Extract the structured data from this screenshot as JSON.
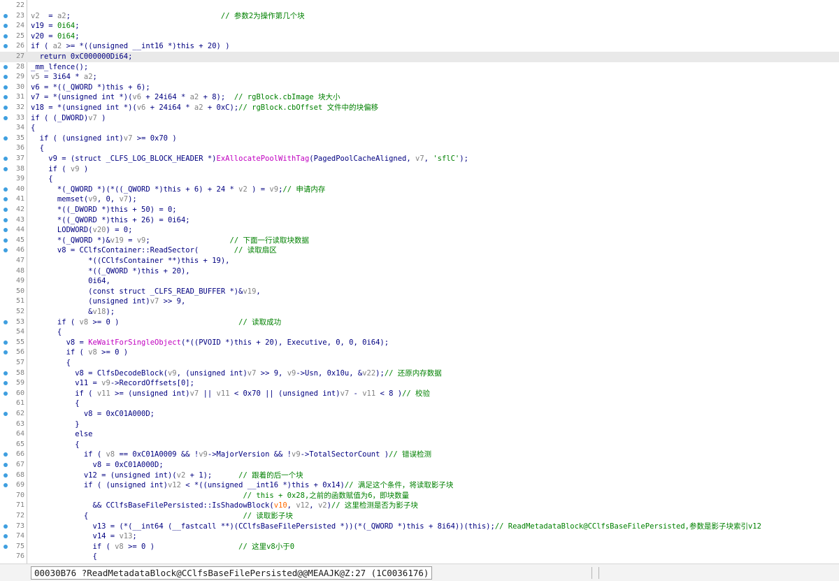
{
  "status": {
    "text": "00030B76 ?ReadMetadataBlock@CClfsBaseFilePersisted@@MEAAJK@Z:27 (1C0036176)"
  },
  "colors": {
    "breakpoint": "#3f9fe0",
    "comment": "#008000",
    "number": "#008000",
    "variable": "#808080",
    "api": "#c000c0",
    "highlight_line": "#e9e9e9"
  },
  "lines": [
    {
      "n": "22",
      "bp": false,
      "hl": false,
      "t": []
    },
    {
      "n": "23",
      "bp": true,
      "hl": false,
      "t": [
        [
          "v",
          "v2"
        ],
        [
          "",
          "  = "
        ],
        [
          "v",
          "a2"
        ],
        [
          "",
          ";                                  "
        ],
        [
          "c",
          "// 参数2为操作第几个块"
        ]
      ]
    },
    {
      "n": "24",
      "bp": true,
      "hl": false,
      "t": [
        [
          "",
          "v19 = "
        ],
        [
          "num",
          "0i64"
        ],
        [
          "",
          ";"
        ]
      ]
    },
    {
      "n": "25",
      "bp": true,
      "hl": false,
      "t": [
        [
          "",
          "v20 = "
        ],
        [
          "num",
          "0i64"
        ],
        [
          "",
          ";"
        ]
      ]
    },
    {
      "n": "26",
      "bp": true,
      "hl": false,
      "t": [
        [
          "",
          "if ( "
        ],
        [
          "v",
          "a2"
        ],
        [
          "",
          " >= *((unsigned __int16 *)"
        ],
        [
          "kw",
          "this"
        ],
        [
          "",
          " + 20) )"
        ]
      ]
    },
    {
      "n": "27",
      "bp": false,
      "hl": true,
      "t": [
        [
          "",
          "  return 0xC000000Di64;"
        ]
      ]
    },
    {
      "n": "28",
      "bp": true,
      "hl": false,
      "t": [
        [
          "",
          "_mm_lfence();"
        ]
      ]
    },
    {
      "n": "29",
      "bp": true,
      "hl": false,
      "t": [
        [
          "v",
          "v5"
        ],
        [
          "",
          " = 3i64 * "
        ],
        [
          "v",
          "a2"
        ],
        [
          "",
          ";"
        ]
      ]
    },
    {
      "n": "30",
      "bp": true,
      "hl": false,
      "t": [
        [
          "",
          "v6 = *((_QWORD *)"
        ],
        [
          "kw",
          "this"
        ],
        [
          "",
          " + 6);"
        ]
      ]
    },
    {
      "n": "31",
      "bp": true,
      "hl": false,
      "t": [
        [
          "",
          "v7 = *(unsigned int *)("
        ],
        [
          "v",
          "v6"
        ],
        [
          "",
          " + 24i64 * "
        ],
        [
          "v",
          "a2"
        ],
        [
          "",
          " + 8);  "
        ],
        [
          "c",
          "// rgBlock.cbImage 块大小"
        ]
      ]
    },
    {
      "n": "32",
      "bp": true,
      "hl": false,
      "t": [
        [
          "",
          "v18 = *(unsigned int *)("
        ],
        [
          "v",
          "v6"
        ],
        [
          "",
          " + 24i64 * "
        ],
        [
          "v",
          "a2"
        ],
        [
          "",
          " + 0xC);"
        ],
        [
          "c",
          "// rgBlock.cbOffset 文件中的块偏移"
        ]
      ]
    },
    {
      "n": "33",
      "bp": true,
      "hl": false,
      "t": [
        [
          "",
          "if ( (_DWORD)"
        ],
        [
          "v",
          "v7"
        ],
        [
          "",
          " )"
        ]
      ]
    },
    {
      "n": "34",
      "bp": false,
      "hl": false,
      "t": [
        [
          "",
          "{"
        ]
      ]
    },
    {
      "n": "35",
      "bp": true,
      "hl": false,
      "t": [
        [
          "",
          "  if ( (unsigned int)"
        ],
        [
          "v",
          "v7"
        ],
        [
          "",
          " >= 0x70 )"
        ]
      ]
    },
    {
      "n": "36",
      "bp": false,
      "hl": false,
      "t": [
        [
          "",
          "  {"
        ]
      ]
    },
    {
      "n": "37",
      "bp": true,
      "hl": false,
      "t": [
        [
          "",
          "    v9 = (struct _CLFS_LOG_BLOCK_HEADER *)"
        ],
        [
          "api",
          "ExAllocatePoolWithTag"
        ],
        [
          "",
          "(PagedPoolCacheAligned, "
        ],
        [
          "v",
          "v7"
        ],
        [
          "",
          ", "
        ],
        [
          "str",
          "'sflC'"
        ],
        [
          "",
          ");"
        ]
      ]
    },
    {
      "n": "38",
      "bp": true,
      "hl": false,
      "t": [
        [
          "",
          "    if ( "
        ],
        [
          "v",
          "v9"
        ],
        [
          "",
          " )"
        ]
      ]
    },
    {
      "n": "39",
      "bp": false,
      "hl": false,
      "t": [
        [
          "",
          "    {"
        ]
      ]
    },
    {
      "n": "40",
      "bp": true,
      "hl": false,
      "t": [
        [
          "",
          "      *(_QWORD *)(*((_QWORD *)"
        ],
        [
          "kw",
          "this"
        ],
        [
          "",
          " + 6) + 24 * "
        ],
        [
          "v",
          "v2"
        ],
        [
          "",
          " ) = "
        ],
        [
          "v",
          "v9"
        ],
        [
          "",
          ";"
        ],
        [
          "c",
          "// 申请内存"
        ]
      ]
    },
    {
      "n": "41",
      "bp": true,
      "hl": false,
      "t": [
        [
          "",
          "      memset("
        ],
        [
          "v",
          "v9"
        ],
        [
          "",
          ", 0, "
        ],
        [
          "v",
          "v7"
        ],
        [
          "",
          ");"
        ]
      ]
    },
    {
      "n": "42",
      "bp": true,
      "hl": false,
      "t": [
        [
          "",
          "      *((_DWORD *)"
        ],
        [
          "kw",
          "this"
        ],
        [
          "",
          " + 50) = 0;"
        ]
      ]
    },
    {
      "n": "43",
      "bp": true,
      "hl": false,
      "t": [
        [
          "",
          "      *((_QWORD *)"
        ],
        [
          "kw",
          "this"
        ],
        [
          "",
          " + 26) = 0i64;"
        ]
      ]
    },
    {
      "n": "44",
      "bp": true,
      "hl": false,
      "t": [
        [
          "",
          "      LODWORD("
        ],
        [
          "v",
          "v20"
        ],
        [
          "",
          ") = 0;"
        ]
      ]
    },
    {
      "n": "45",
      "bp": true,
      "hl": false,
      "t": [
        [
          "",
          "      *(_QWORD *)&"
        ],
        [
          "v",
          "v19"
        ],
        [
          "",
          " = "
        ],
        [
          "v",
          "v9"
        ],
        [
          "",
          ";                  "
        ],
        [
          "c",
          "// 下面一行读取块数据"
        ]
      ]
    },
    {
      "n": "46",
      "bp": true,
      "hl": false,
      "t": [
        [
          "",
          "      v8 = CClfsContainer::ReadSector(        "
        ],
        [
          "c",
          "// 读取扇区"
        ]
      ]
    },
    {
      "n": "47",
      "bp": false,
      "hl": false,
      "t": [
        [
          "",
          "             *((CClfsContainer **)"
        ],
        [
          "kw",
          "this"
        ],
        [
          "",
          " + 19),"
        ]
      ]
    },
    {
      "n": "48",
      "bp": false,
      "hl": false,
      "t": [
        [
          "",
          "             *((_QWORD *)"
        ],
        [
          "kw",
          "this"
        ],
        [
          "",
          " + 20),"
        ]
      ]
    },
    {
      "n": "49",
      "bp": false,
      "hl": false,
      "t": [
        [
          "",
          "             0i64,"
        ]
      ]
    },
    {
      "n": "50",
      "bp": false,
      "hl": false,
      "t": [
        [
          "",
          "             (const struct _CLFS_READ_BUFFER *)&"
        ],
        [
          "v",
          "v19"
        ],
        [
          "",
          ","
        ]
      ]
    },
    {
      "n": "51",
      "bp": false,
      "hl": false,
      "t": [
        [
          "",
          "             (unsigned int)"
        ],
        [
          "v",
          "v7"
        ],
        [
          "",
          " >> 9,"
        ]
      ]
    },
    {
      "n": "52",
      "bp": false,
      "hl": false,
      "t": [
        [
          "",
          "             &"
        ],
        [
          "v",
          "v18"
        ],
        [
          "",
          ");"
        ]
      ]
    },
    {
      "n": "53",
      "bp": true,
      "hl": false,
      "t": [
        [
          "",
          "      if ( "
        ],
        [
          "v",
          "v8"
        ],
        [
          "",
          " >= 0 )                           "
        ],
        [
          "c",
          "// 读取成功"
        ]
      ]
    },
    {
      "n": "54",
      "bp": false,
      "hl": false,
      "t": [
        [
          "",
          "      {"
        ]
      ]
    },
    {
      "n": "55",
      "bp": true,
      "hl": false,
      "t": [
        [
          "",
          "        v8 = "
        ],
        [
          "api",
          "KeWaitForSingleObject"
        ],
        [
          "",
          "(*((PVOID *)"
        ],
        [
          "kw",
          "this"
        ],
        [
          "",
          " + 20), Executive, 0, 0, 0i64);"
        ]
      ]
    },
    {
      "n": "56",
      "bp": true,
      "hl": false,
      "t": [
        [
          "",
          "        if ( "
        ],
        [
          "v",
          "v8"
        ],
        [
          "",
          " >= 0 )"
        ]
      ]
    },
    {
      "n": "57",
      "bp": false,
      "hl": false,
      "t": [
        [
          "",
          "        {"
        ]
      ]
    },
    {
      "n": "58",
      "bp": true,
      "hl": false,
      "t": [
        [
          "",
          "          v8 = ClfsDecodeBlock("
        ],
        [
          "v",
          "v9"
        ],
        [
          "",
          ", (unsigned int)"
        ],
        [
          "v",
          "v7"
        ],
        [
          "",
          " >> 9, "
        ],
        [
          "v",
          "v9"
        ],
        [
          "",
          "->Usn, 0x10u, &"
        ],
        [
          "v",
          "v22"
        ],
        [
          "",
          ");"
        ],
        [
          "c",
          "// 还原内存数据"
        ]
      ]
    },
    {
      "n": "59",
      "bp": true,
      "hl": false,
      "t": [
        [
          "",
          "          v11 = "
        ],
        [
          "v",
          "v9"
        ],
        [
          "",
          "->RecordOffsets[0];"
        ]
      ]
    },
    {
      "n": "60",
      "bp": true,
      "hl": false,
      "t": [
        [
          "",
          "          if ( "
        ],
        [
          "v",
          "v11"
        ],
        [
          "",
          " >= (unsigned int)"
        ],
        [
          "v",
          "v7"
        ],
        [
          "",
          " || "
        ],
        [
          "v",
          "v11"
        ],
        [
          "",
          " < 0x70 || (unsigned int)"
        ],
        [
          "v",
          "v7"
        ],
        [
          "",
          " - "
        ],
        [
          "v",
          "v11"
        ],
        [
          "",
          " < 8 )"
        ],
        [
          "c",
          "// 校验"
        ]
      ]
    },
    {
      "n": "61",
      "bp": false,
      "hl": false,
      "t": [
        [
          "",
          "          {"
        ]
      ]
    },
    {
      "n": "62",
      "bp": true,
      "hl": false,
      "t": [
        [
          "",
          "            v8 = 0xC01A000D;"
        ]
      ]
    },
    {
      "n": "63",
      "bp": false,
      "hl": false,
      "t": [
        [
          "",
          "          }"
        ]
      ]
    },
    {
      "n": "64",
      "bp": false,
      "hl": false,
      "t": [
        [
          "",
          "          else"
        ]
      ]
    },
    {
      "n": "65",
      "bp": false,
      "hl": false,
      "t": [
        [
          "",
          "          {"
        ]
      ]
    },
    {
      "n": "66",
      "bp": true,
      "hl": false,
      "t": [
        [
          "",
          "            if ( "
        ],
        [
          "v",
          "v8"
        ],
        [
          "",
          " == 0xC01A0009 && !"
        ],
        [
          "v",
          "v9"
        ],
        [
          "",
          "->MajorVersion && !"
        ],
        [
          "v",
          "v9"
        ],
        [
          "",
          "->TotalSectorCount )"
        ],
        [
          "c",
          "// 错误检测"
        ]
      ]
    },
    {
      "n": "67",
      "bp": true,
      "hl": false,
      "t": [
        [
          "",
          "              v8 = 0xC01A000D;"
        ]
      ]
    },
    {
      "n": "68",
      "bp": true,
      "hl": false,
      "t": [
        [
          "",
          "            v12 = (unsigned int)("
        ],
        [
          "v",
          "v2"
        ],
        [
          "",
          " + 1);      "
        ],
        [
          "c",
          "// 跟着的后一个块"
        ]
      ]
    },
    {
      "n": "69",
      "bp": true,
      "hl": false,
      "t": [
        [
          "",
          "            if ( (unsigned int)"
        ],
        [
          "v",
          "v12"
        ],
        [
          "",
          " < *((unsigned __int16 *)"
        ],
        [
          "kw",
          "this"
        ],
        [
          "",
          " + 0x14)"
        ],
        [
          "c",
          "// 满足这个条件，将读取影子块"
        ]
      ]
    },
    {
      "n": "70",
      "bp": false,
      "hl": false,
      "t": [
        [
          "",
          "                                                "
        ],
        [
          "c",
          "// this + 0x28,之前的函数赋值为6，即块数量"
        ]
      ]
    },
    {
      "n": "71",
      "bp": false,
      "hl": false,
      "t": [
        [
          "",
          "              && CClfsBaseFilePersisted::IsShadowBlock("
        ],
        [
          "ref",
          "v10"
        ],
        [
          "",
          ", "
        ],
        [
          "v",
          "v12"
        ],
        [
          "",
          ", "
        ],
        [
          "v",
          "v2"
        ],
        [
          "",
          ")"
        ],
        [
          "c",
          "// 这里检测是否为影子块"
        ]
      ]
    },
    {
      "n": "72",
      "bp": false,
      "hl": false,
      "t": [
        [
          "",
          "            {                                   "
        ],
        [
          "c",
          "// 读取影子块"
        ]
      ]
    },
    {
      "n": "73",
      "bp": true,
      "hl": false,
      "t": [
        [
          "",
          "              v13 = (*(__int64 (__fastcall **)(CClfsBaseFilePersisted *))(*(_QWORD *)"
        ],
        [
          "kw",
          "this"
        ],
        [
          "",
          " + 8i64))("
        ],
        [
          "kw",
          "this"
        ],
        [
          "",
          ");"
        ],
        [
          "c",
          "// ReadMetadataBlock@CClfsBaseFilePersisted,参数是影子块索引v12"
        ]
      ]
    },
    {
      "n": "74",
      "bp": true,
      "hl": false,
      "t": [
        [
          "",
          "              v14 = "
        ],
        [
          "v",
          "v13"
        ],
        [
          "",
          ";"
        ]
      ]
    },
    {
      "n": "75",
      "bp": true,
      "hl": false,
      "t": [
        [
          "",
          "              if ( "
        ],
        [
          "v",
          "v8"
        ],
        [
          "",
          " >= 0 )                   "
        ],
        [
          "c",
          "// 这里v8小于0"
        ]
      ]
    },
    {
      "n": "76",
      "bp": false,
      "hl": false,
      "t": [
        [
          "",
          "              {"
        ]
      ]
    }
  ]
}
